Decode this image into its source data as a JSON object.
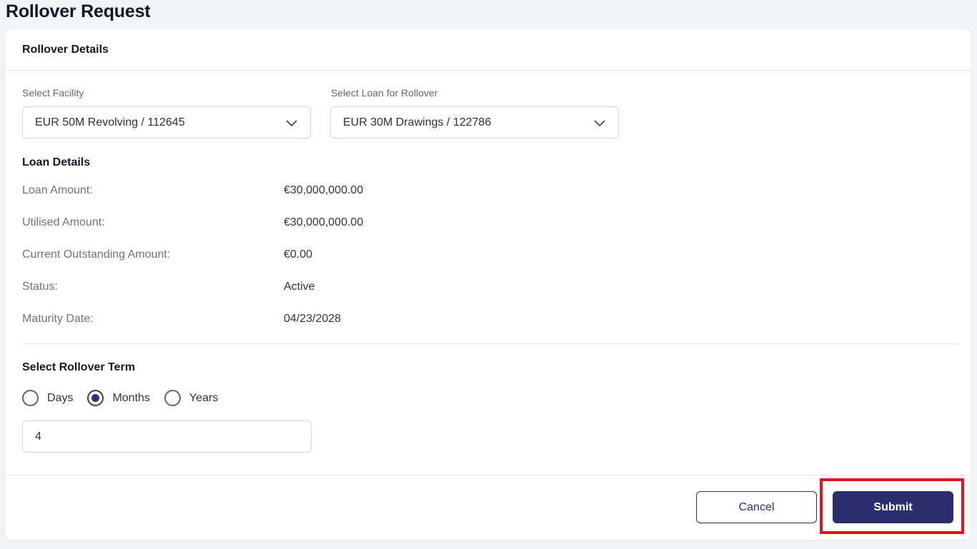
{
  "page_title": "Rollover Request",
  "card": {
    "title": "Rollover Details"
  },
  "facility": {
    "label": "Select Facility",
    "value": "EUR 50M Revolving / 112645"
  },
  "loan_select": {
    "label": "Select Loan for Rollover",
    "value": "EUR 30M Drawings / 122786"
  },
  "loan_details": {
    "title": "Loan Details",
    "rows": [
      {
        "label": "Loan Amount:",
        "value": "€30,000,000.00"
      },
      {
        "label": "Utilised Amount:",
        "value": "€30,000,000.00"
      },
      {
        "label": "Current Outstanding Amount:",
        "value": "€0.00"
      },
      {
        "label": "Status:",
        "value": "Active"
      },
      {
        "label": "Maturity Date:",
        "value": "04/23/2028"
      }
    ]
  },
  "rollover_term": {
    "title": "Select Rollover Term",
    "options": [
      {
        "label": "Days",
        "checked": false
      },
      {
        "label": "Months",
        "checked": true
      },
      {
        "label": "Years",
        "checked": false
      }
    ],
    "value": "4"
  },
  "actions": {
    "cancel_label": "Cancel",
    "submit_label": "Submit"
  },
  "colors": {
    "primary": "#2b2f6e",
    "highlight": "#e0161e",
    "background": "#f1f4f7"
  },
  "icons": {
    "dropdown": "chevron-down-icon"
  }
}
